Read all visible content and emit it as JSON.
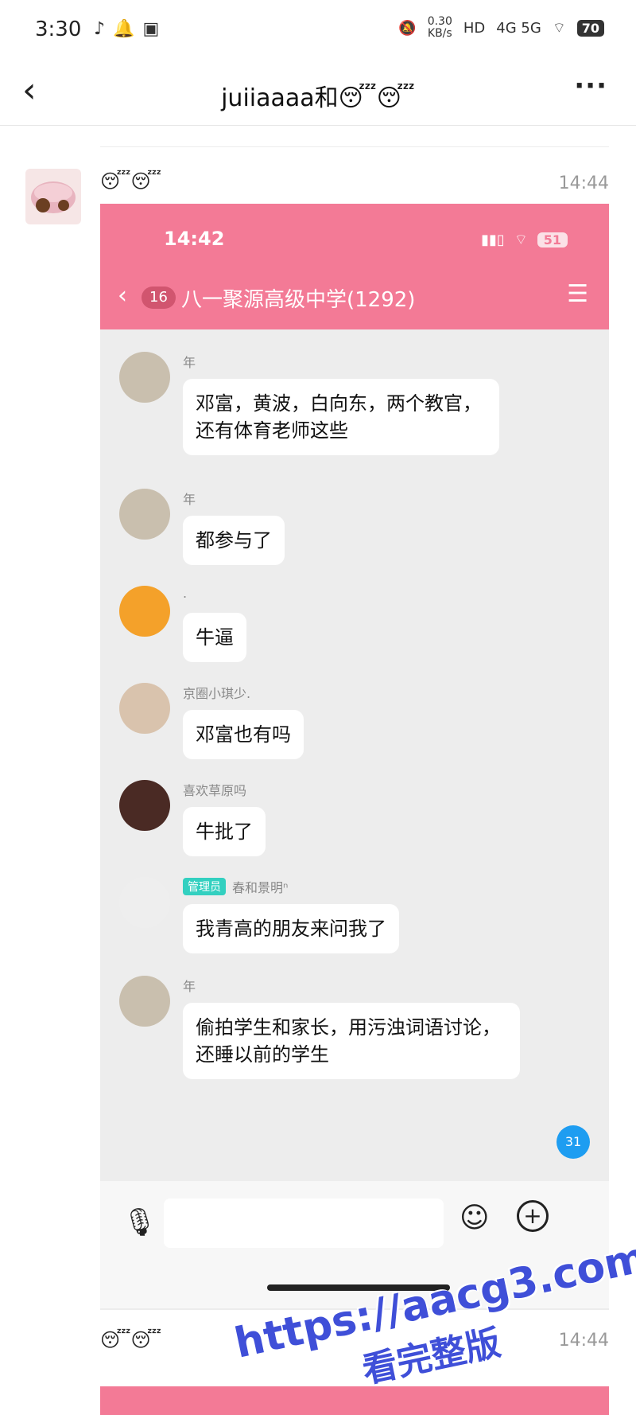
{
  "status_bar": {
    "time": "3:30",
    "speed": "0.30",
    "speed_unit": "KB/s",
    "network": "4G 5G",
    "battery": "70"
  },
  "header": {
    "title": "juiiaaaa和😴😴"
  },
  "post": {
    "sender_emoji": "😴😴",
    "time": "14:44"
  },
  "inner": {
    "time": "14:42",
    "battery": "51",
    "unread_badge": "16",
    "group_title": "八一聚源高级中学(1292)",
    "messages": [
      {
        "name": "年",
        "text": "邓富，黄波，白向东，两个教官，还有体育老师这些"
      },
      {
        "name": "年",
        "text": "都参与了"
      },
      {
        "name": ".",
        "text": "牛逼"
      },
      {
        "name": "京圈小琪少.",
        "text": "邓富也有吗"
      },
      {
        "name": "喜欢草原吗",
        "text": "牛批了"
      },
      {
        "name": "春和景明ⁿ",
        "role": "管理员",
        "text": "我青高的朋友来问我了"
      },
      {
        "name": "年",
        "text": "偷拍学生和家长，用污浊词语讨论，还睡以前的学生"
      }
    ],
    "new_count": "31"
  },
  "post2": {
    "sender_emoji": "😴😴",
    "time": "14:44"
  },
  "watermark": {
    "line1": "https://aacg3.com",
    "line2": "看完整版"
  },
  "colors": {
    "accent_pink": "#f37a96",
    "admin_badge": "#33d0c0",
    "unread_blue": "#1e9df1"
  }
}
